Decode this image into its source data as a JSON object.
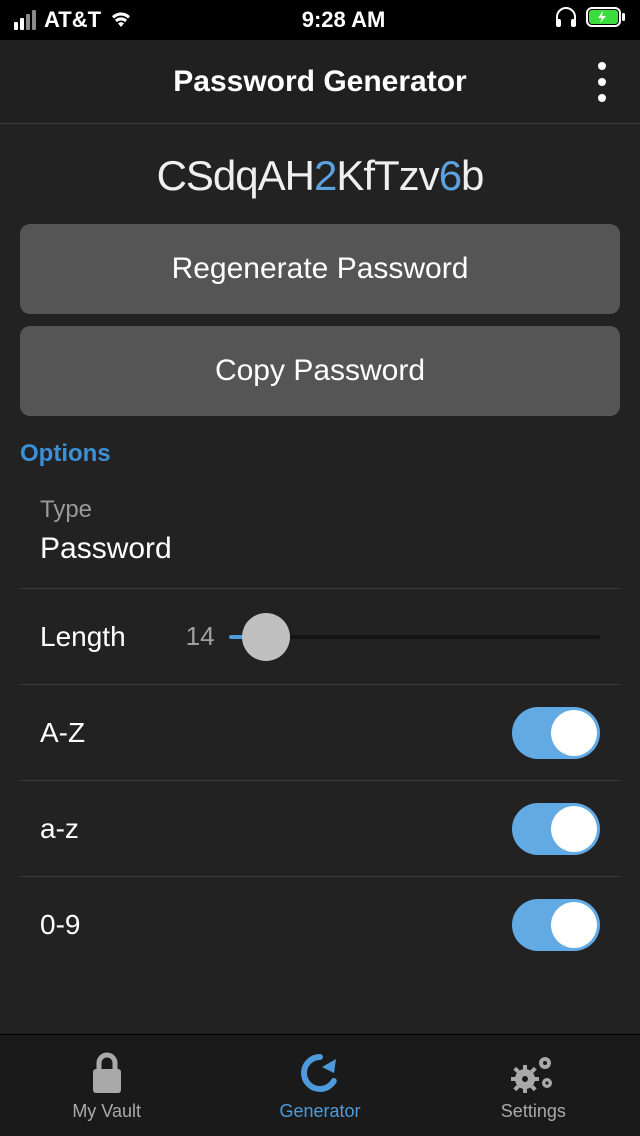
{
  "status": {
    "carrier": "AT&T",
    "time": "9:28 AM"
  },
  "header": {
    "title": "Password Generator"
  },
  "password": {
    "segments": [
      {
        "text": "CSdqAH",
        "digit": false
      },
      {
        "text": "2",
        "digit": true
      },
      {
        "text": "KfTzv",
        "digit": false
      },
      {
        "text": "6",
        "digit": true
      },
      {
        "text": "b",
        "digit": false
      }
    ]
  },
  "buttons": {
    "regenerate": "Regenerate Password",
    "copy": "Copy Password"
  },
  "options": {
    "section_label": "Options",
    "type_label": "Type",
    "type_value": "Password",
    "length_label": "Length",
    "length_value": "14",
    "rows": {
      "upper": {
        "label": "A-Z",
        "on": true
      },
      "lower": {
        "label": "a-z",
        "on": true
      },
      "digits": {
        "label": "0-9",
        "on": true
      }
    }
  },
  "tabs": {
    "vault": "My Vault",
    "generator": "Generator",
    "settings": "Settings"
  }
}
